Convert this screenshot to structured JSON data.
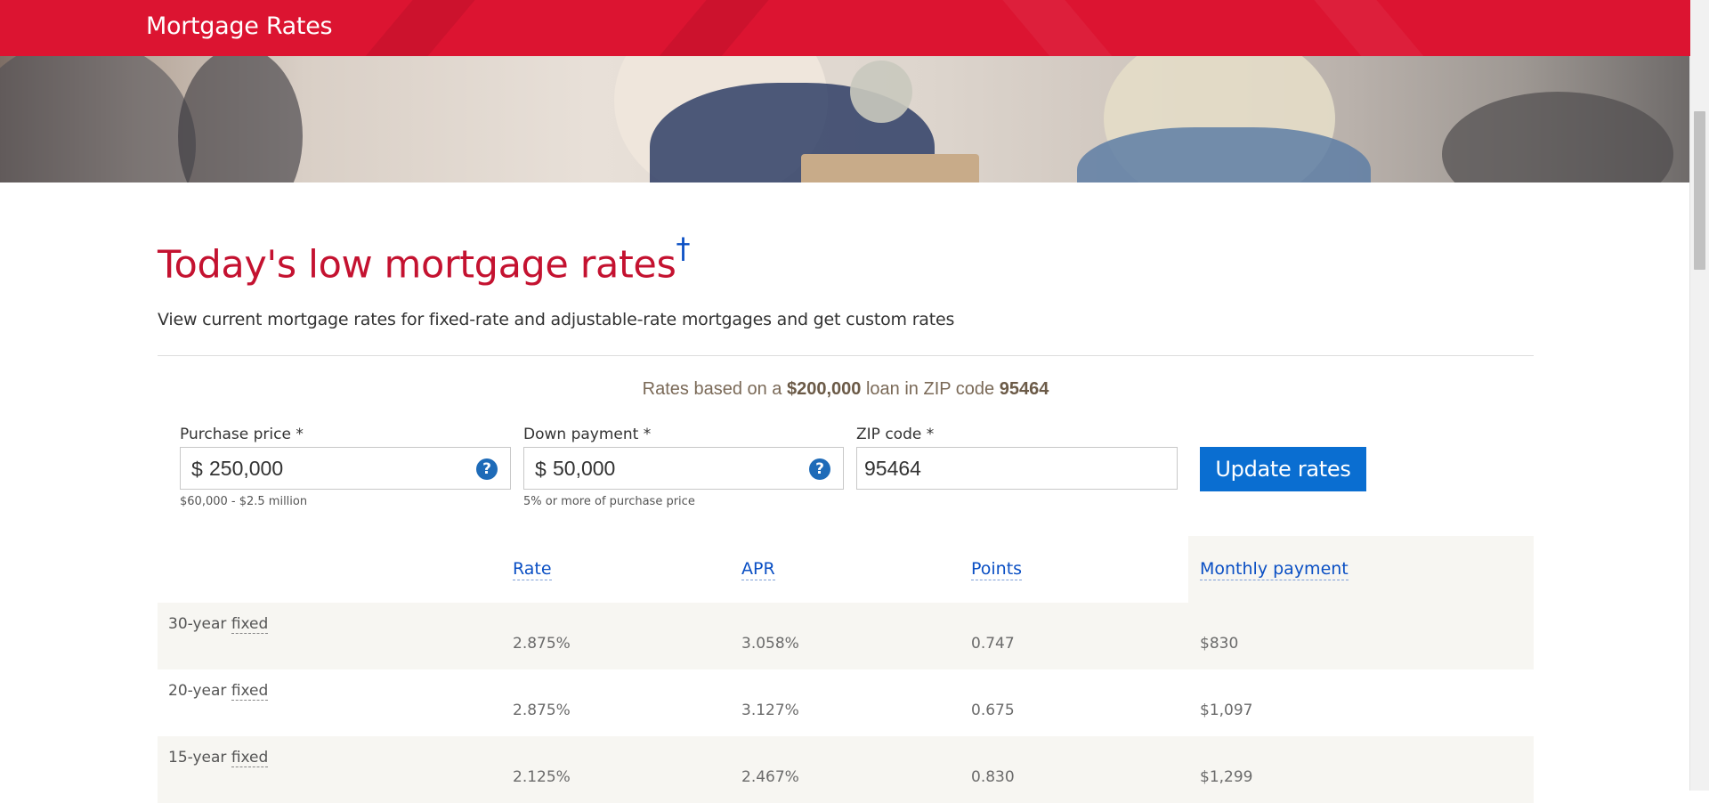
{
  "header": {
    "title": "Mortgage Rates"
  },
  "main": {
    "heading": "Today's low mortgage rates",
    "heading_mark": "†",
    "subtitle": "View current mortgage rates for fixed-rate and adjustable-rate mortgages and get custom rates",
    "rates_basis": {
      "prefix": "Rates based on a ",
      "loan_amount": "$200,000",
      "middle": " loan in ZIP code ",
      "zip": "95464"
    }
  },
  "form": {
    "purchase_price": {
      "label": "Purchase price *",
      "prefix": "$",
      "value": "250,000",
      "hint": "$60,000 - $2.5 million",
      "help_icon": "question-circle-icon"
    },
    "down_payment": {
      "label": "Down payment *",
      "prefix": "$",
      "value": "50,000",
      "hint": "5% or more of purchase price",
      "help_icon": "question-circle-icon"
    },
    "zip_code": {
      "label": "ZIP code *",
      "value": "95464"
    },
    "update_button": "Update rates"
  },
  "rates_table": {
    "columns": [
      "Rate",
      "APR",
      "Points",
      "Monthly payment"
    ],
    "rows": [
      {
        "term": "30-year",
        "type": "fixed",
        "rate": "2.875%",
        "apr": "3.058%",
        "points": "0.747",
        "monthly_payment": "$830"
      },
      {
        "term": "20-year",
        "type": "fixed",
        "rate": "2.875%",
        "apr": "3.127%",
        "points": "0.675",
        "monthly_payment": "$1,097"
      },
      {
        "term": "15-year",
        "type": "fixed",
        "rate": "2.125%",
        "apr": "2.467%",
        "points": "0.830",
        "monthly_payment": "$1,299"
      }
    ]
  },
  "colors": {
    "brand_red": "#dc1431",
    "heading_red": "#c41230",
    "link_blue": "#0a4fc4",
    "button_blue": "#0a6ed1"
  }
}
